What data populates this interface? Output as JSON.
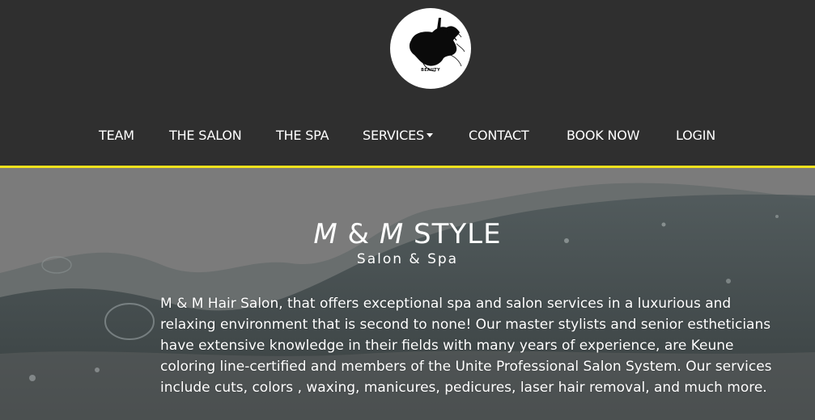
{
  "logo": {
    "icon": "hair-silhouette-logo",
    "text": "BEAUTY"
  },
  "nav": {
    "items": [
      {
        "label": "TEAM"
      },
      {
        "label": "THE SALON"
      },
      {
        "label": "THE SPA"
      },
      {
        "label": "SERVICES",
        "has_dropdown": true
      },
      {
        "label": "CONTACT"
      },
      {
        "label": "BOOK NOW"
      },
      {
        "label": "LOGIN"
      }
    ]
  },
  "hero": {
    "title_part1": "M",
    "title_amp": " & ",
    "title_part2": "M",
    "title_part3": " STYLE",
    "subtitle": "Salon & Spa",
    "description": "M & M Hair Salon, that offers exceptional spa and salon services in a luxurious and relaxing environment that is second to none! Our master stylists and senior estheticians have extensive knowledge in their fields with many years of experience, are Keune coloring line-certified and members of the Unite Professional Salon System. Our services include cuts, colors , waxing, manicures, pedicures, laser hair removal, and much more."
  },
  "colors": {
    "header_bg": "#2f2f2f",
    "accent_rule": "#f3e21d",
    "hero_bg": "#7a7a7a",
    "text": "#ffffff"
  }
}
